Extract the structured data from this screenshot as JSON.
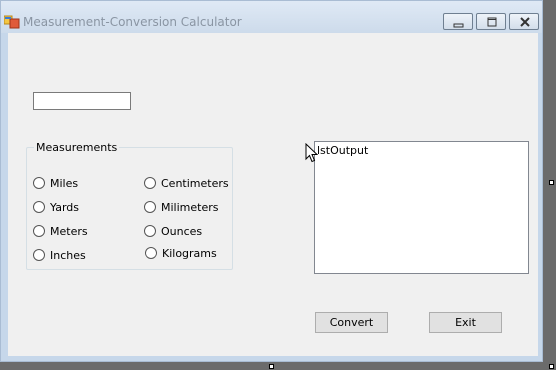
{
  "window": {
    "title": "Measurement-Conversion Calculator",
    "icon": "app-form-icon",
    "controls": [
      "minimize-icon",
      "maximize-icon",
      "close-icon"
    ]
  },
  "input": {
    "value": "",
    "placeholder": ""
  },
  "measurements": {
    "label": "Measurements",
    "options": [
      "Miles",
      "Yards",
      "Meters",
      "Inches",
      "Centimeters",
      "Milimeters",
      "Ounces",
      "Kilograms"
    ]
  },
  "output": {
    "items": [
      "lstOutput"
    ]
  },
  "buttons": {
    "convert": "Convert",
    "exit": "Exit"
  }
}
